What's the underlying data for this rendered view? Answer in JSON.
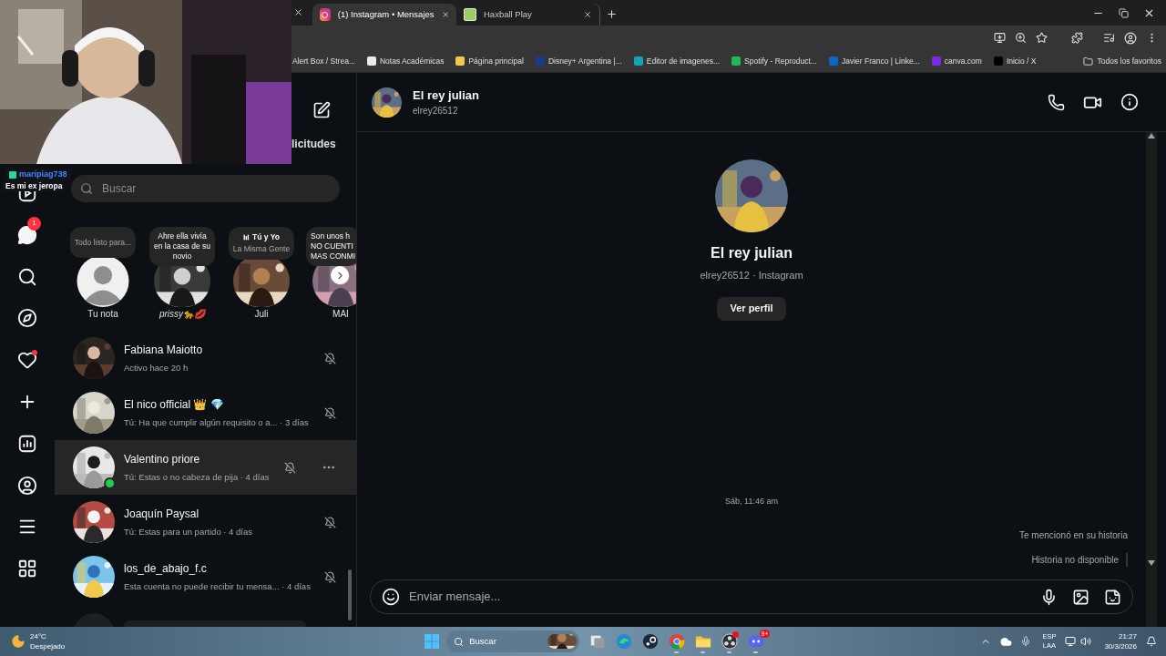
{
  "browser": {
    "tabs": [
      {
        "title": "(1) Instagram • Mensajes",
        "kind": "instagram",
        "selected": true
      },
      {
        "title": "Haxball Play",
        "kind": "haxball",
        "selected": false
      }
    ],
    "bookmarks": [
      {
        "title": "Alert Box / Strea..."
      },
      {
        "title": "Notas Académicas",
        "color": "#e8eaed"
      },
      {
        "title": "Página principal",
        "color": "#f2c94c"
      },
      {
        "title": "Disney+ Argentina |...",
        "color": "#1a3a8a"
      },
      {
        "title": "Editor de imagenes...",
        "color": "#17a2b8"
      },
      {
        "title": "Spotify - Reproduct...",
        "color": "#1db954"
      },
      {
        "title": "Javier Franco | Linke...",
        "color": "#0a66c2"
      },
      {
        "title": "canva.com",
        "color": "#7d2ae8"
      },
      {
        "title": "Inicio / X",
        "color": "#000000"
      }
    ],
    "all_bookmarks": "Todos los favoritos"
  },
  "overlay": {
    "user": "maripiag738",
    "message": "Es mi ex jeropa"
  },
  "nav": [
    {
      "kind": "reels"
    },
    {
      "kind": "messages",
      "badge": "1"
    },
    {
      "kind": "search"
    },
    {
      "kind": "explore"
    },
    {
      "kind": "notifications",
      "dot": true
    },
    {
      "kind": "create"
    },
    {
      "kind": "dashboard"
    },
    {
      "kind": "profile"
    },
    {
      "kind": "menu"
    },
    {
      "kind": "apps"
    }
  ],
  "inbox": {
    "requests_label": "licitudes",
    "search": {
      "placeholder": "Buscar"
    },
    "notes": [
      {
        "kind": "self",
        "lines": [
          "Todo listo para..."
        ],
        "name": "Tu nota"
      },
      {
        "kind": "text",
        "lines": [
          "Ahre ella vivía",
          "en la casa de su",
          "novio"
        ],
        "name": "prissy🐆💋"
      },
      {
        "kind": "song",
        "lines": [
          "Tú y Yo",
          "La Misma Gente"
        ],
        "name": "Juli"
      },
      {
        "kind": "text",
        "lines": [
          "Son unos h",
          "NO CUENTI",
          "MAS CONMI"
        ],
        "name": "MAI"
      }
    ],
    "conversations": [
      {
        "name": "Fabiana Maiotto",
        "preview": "Activo hace 20 h",
        "online": false,
        "muted": true,
        "selected": false
      },
      {
        "name": "El nico official 👑 💎",
        "preview": "Tú: Ha que cumplir algún requisito o a... · 3 días",
        "online": false,
        "muted": true,
        "selected": false
      },
      {
        "name": "Valentino priore",
        "preview": "Tú: Estas o no cabeza de pija · 4 días",
        "online": true,
        "muted": true,
        "selected": true
      },
      {
        "name": "Joaquín Paysal",
        "preview": "Tú: Estas para un partido · 4 días",
        "online": false,
        "muted": true,
        "selected": false
      },
      {
        "name": "los_de_abajo_f.c",
        "preview": "Esta cuenta no puede recibir tu mensa... · 4 días",
        "online": false,
        "muted": true,
        "selected": false
      }
    ]
  },
  "chat": {
    "contact": {
      "name": "El rey julian",
      "username": "elrey26512"
    },
    "profile": {
      "name": "El rey julian",
      "subtitle": "elrey26512 · Instagram",
      "button": "Ver perfil"
    },
    "timestamp": "Sáb, 11:46 am",
    "story_reply": {
      "label": "Te mencionó en su historia",
      "status": "Historia no disponible"
    },
    "composer": {
      "placeholder": "Enviar mensaje..."
    }
  },
  "taskbar": {
    "weather": {
      "temperature": "24°C",
      "condition": "Despejado"
    },
    "search": {
      "placeholder": "Buscar"
    },
    "apps": [
      {
        "kind": "taskview",
        "running": false
      },
      {
        "kind": "edge",
        "running": false
      },
      {
        "kind": "steam",
        "running": false
      },
      {
        "kind": "chrome",
        "running": true
      },
      {
        "kind": "explorer",
        "running": true
      },
      {
        "kind": "obs",
        "running": true,
        "dot": true
      },
      {
        "kind": "discord",
        "running": true,
        "badge": "9+"
      }
    ],
    "language": "ESP",
    "layout": "LAA",
    "time": "21:27",
    "date": "30/3/2026"
  }
}
